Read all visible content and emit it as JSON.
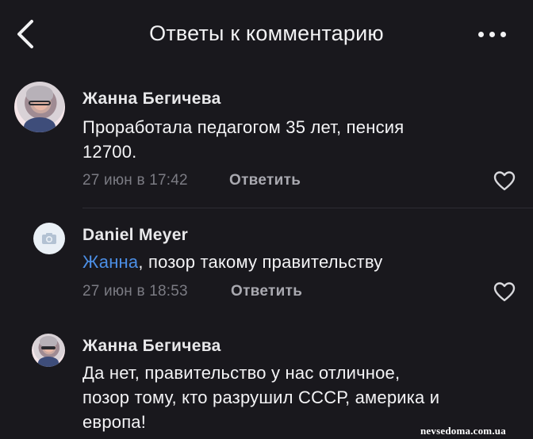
{
  "header": {
    "title": "Ответы к комментарию",
    "back_icon": "chevron-left-icon",
    "more_icon": "more-dots-icon"
  },
  "comments": [
    {
      "author": "Жанна Бегичева",
      "avatar": "user-photo",
      "text": [
        "Проработала педагогом 35 лет, пенсия",
        "12700."
      ],
      "time": "27 июн в 17:42",
      "reply_label": "Ответить"
    },
    {
      "author": "Daniel Meyer",
      "avatar": "camera-placeholder-icon",
      "mention": "Жанна",
      "text": ", позор такому правительству",
      "time": "27 июн в 18:53",
      "reply_label": "Ответить"
    },
    {
      "author": "Жанна Бегичева",
      "avatar": "user-photo",
      "text": [
        "Да нет, правительство у нас отличное,",
        "позор тому, кто разрушил СССР, америка и",
        "европа!"
      ]
    }
  ],
  "watermark": "nevsedoma.com.ua",
  "colors": {
    "background": "#19181d",
    "mention": "#4c8fe6",
    "meta": "#7b7b83"
  }
}
